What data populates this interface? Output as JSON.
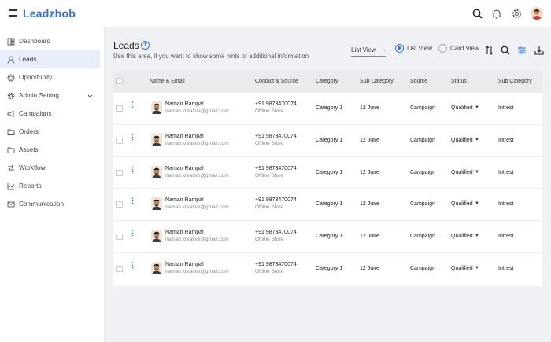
{
  "app": {
    "logo_main": "Leadzh",
    "logo_o": "o",
    "logo_tail": "b"
  },
  "colors": {
    "accent": "#2f6fde",
    "sidebar_active": "#e8eefb",
    "page_bg": "#f0f1f5"
  },
  "topbar": {
    "icons": [
      "search-icon",
      "bell-icon",
      "gear-icon",
      "avatar"
    ]
  },
  "sidebar": {
    "items": [
      {
        "label": "Dashboard",
        "icon": "dashboard-icon"
      },
      {
        "label": "Leads",
        "icon": "user-icon",
        "active": true
      },
      {
        "label": "Opportunity",
        "icon": "target-icon"
      },
      {
        "label": "Admin Setting",
        "icon": "gear-icon",
        "has_chevron": true
      },
      {
        "label": "Campaigns",
        "icon": "megaphone-icon"
      },
      {
        "label": "Orders",
        "icon": "folder-icon"
      },
      {
        "label": "Assets",
        "icon": "folder-icon"
      },
      {
        "label": "Workflow",
        "icon": "workflow-icon"
      },
      {
        "label": "Reports",
        "icon": "chart-icon"
      },
      {
        "label": "Communication",
        "icon": "mail-icon"
      }
    ]
  },
  "page": {
    "title": "Leads",
    "hint": "Use this area, if you want to show some hints or additional information",
    "view_select": "List View",
    "radio_list": "List View",
    "radio_card": "Card View",
    "selected_view": "List View"
  },
  "table": {
    "headers": [
      "Name & Email",
      "Contact & Source",
      "Category",
      "Sub Category",
      "Source",
      "Status",
      "Sub Category"
    ],
    "rows": [
      {
        "name": "Naman Rampal",
        "email": "naman.kreative@gmail.com",
        "phone": "+91 9873470074",
        "contact_source": "Offline Store",
        "category": "Category 1",
        "sub_category": "12 June",
        "source": "Campaign",
        "status": "Qualified",
        "sub_category2": "Intrest"
      },
      {
        "name": "Naman Rampal",
        "email": "naman.kreative@gmail.com",
        "phone": "+91 9873470074",
        "contact_source": "Offline Store",
        "category": "Category 1",
        "sub_category": "12 June",
        "source": "Campaign",
        "status": "Qualified",
        "sub_category2": "Intrest"
      },
      {
        "name": "Naman Rampal",
        "email": "naman.kreative@gmail.com",
        "phone": "+91 9873470074",
        "contact_source": "Offline Store",
        "category": "Category 1",
        "sub_category": "12 June",
        "source": "Campaign",
        "status": "Qualified",
        "sub_category2": "Intrest"
      },
      {
        "name": "Naman Rampal",
        "email": "naman.kreative@gmail.com",
        "phone": "+91 9873470074",
        "contact_source": "Offline Store",
        "category": "Category 1",
        "sub_category": "12 June",
        "source": "Campaign",
        "status": "Qualified",
        "sub_category2": "Intrest"
      },
      {
        "name": "Naman Rampal",
        "email": "naman.kreative@gmail.com",
        "phone": "+91 9873470074",
        "contact_source": "Offline Store",
        "category": "Category 1",
        "sub_category": "12 June",
        "source": "Campaign",
        "status": "Qualified",
        "sub_category2": "Intrest"
      },
      {
        "name": "Naman Rampal",
        "email": "naman.kreative@gmail.com",
        "phone": "+91 9873470074",
        "contact_source": "Offline Store",
        "category": "Category 1",
        "sub_category": "12 June",
        "source": "Campaign",
        "status": "Qualified",
        "sub_category2": "Intrest"
      }
    ]
  }
}
